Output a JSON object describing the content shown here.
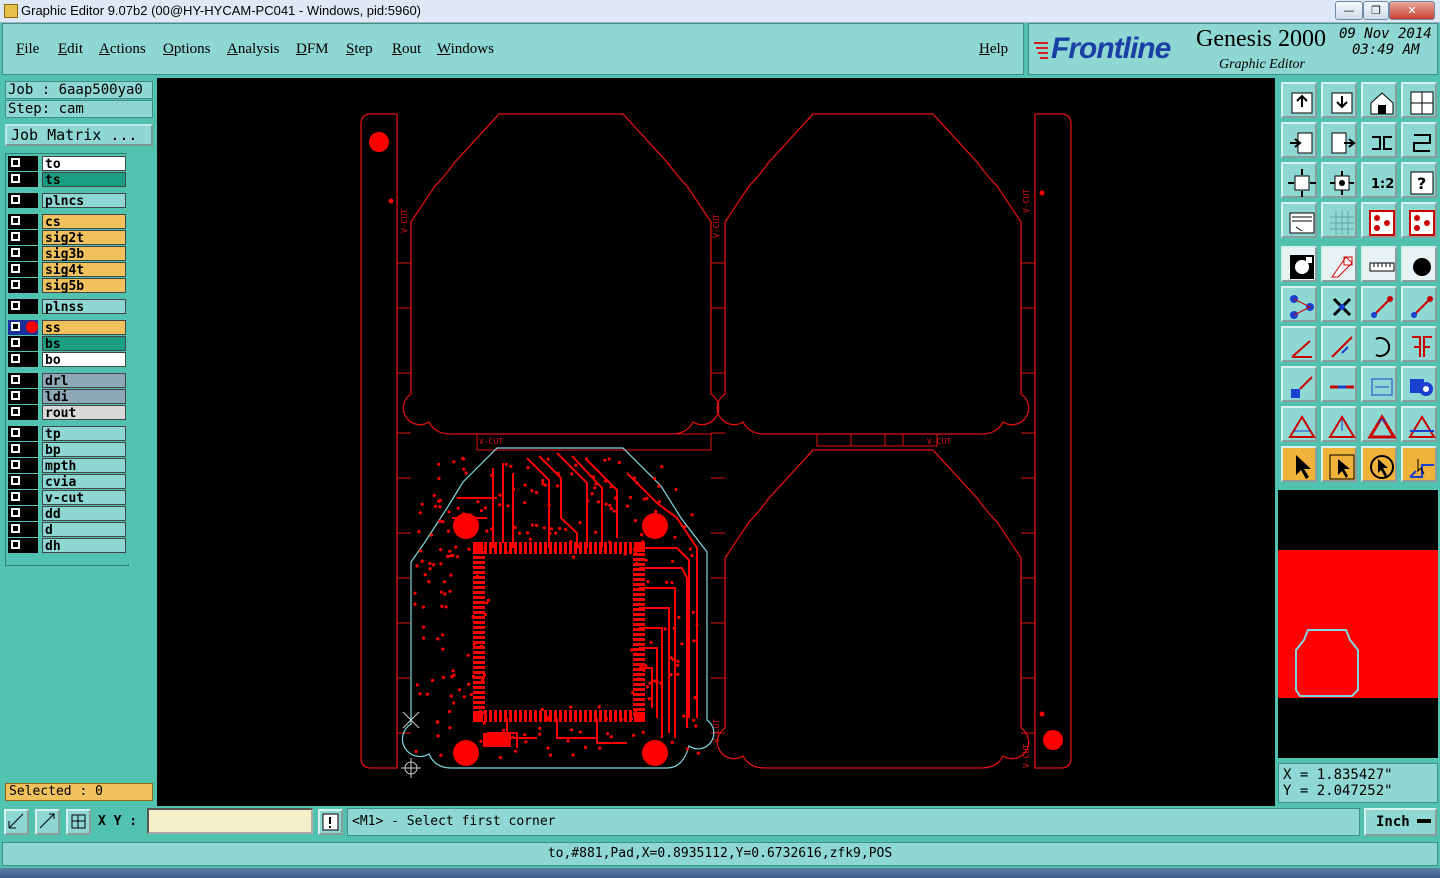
{
  "window": {
    "title": "Graphic Editor 9.07b2 (00@HY-HYCAM-PC041 - Windows, pid:5960)",
    "minimize": "—",
    "maximize": "❐",
    "close": "✕"
  },
  "menubar": {
    "items": [
      "File",
      "Edit",
      "Actions",
      "Options",
      "Analysis",
      "DFM",
      "Step",
      "Rout",
      "Windows"
    ],
    "help": "Help"
  },
  "brand": {
    "logo": "Frontline",
    "product": "Genesis 2000",
    "subtitle": "Graphic Editor",
    "date": "09 Nov 2014",
    "time": "03:49 AM"
  },
  "job": {
    "job_label": "Job : 6aap500ya0",
    "step_label": "Step: cam",
    "matrix_button": "Job Matrix ..."
  },
  "layers": [
    {
      "name": "to",
      "color": "#ffffff"
    },
    {
      "name": "ts",
      "color": "#199e82"
    },
    {
      "name": "plncs",
      "color": "#8fd7d3"
    },
    {
      "name": "cs",
      "color": "#f0c15c"
    },
    {
      "name": "sig2t",
      "color": "#f0c15c"
    },
    {
      "name": "sig3b",
      "color": "#f0c15c"
    },
    {
      "name": "sig4t",
      "color": "#f0c15c"
    },
    {
      "name": "sig5b",
      "color": "#f0c15c"
    },
    {
      "name": "plnss",
      "color": "#8fd7d3"
    },
    {
      "name": "ss",
      "color": "#f0c15c"
    },
    {
      "name": "bs",
      "color": "#199e82"
    },
    {
      "name": "bo",
      "color": "#ffffff"
    },
    {
      "name": "drl",
      "color": "#8fa8b8"
    },
    {
      "name": "ldi",
      "color": "#8fa8b8"
    },
    {
      "name": "rout",
      "color": "#d8d8d8"
    },
    {
      "name": "tp",
      "color": "#8fd7d3"
    },
    {
      "name": "bp",
      "color": "#8fd7d3"
    },
    {
      "name": "mpth",
      "color": "#8fd7d3"
    },
    {
      "name": "cvia",
      "color": "#8fd7d3"
    },
    {
      "name": "v-cut",
      "color": "#8fd7d3"
    },
    {
      "name": "dd",
      "color": "#8fd7d3"
    },
    {
      "name": "d",
      "color": "#8fd7d3"
    },
    {
      "name": "dh",
      "color": "#8fd7d3"
    }
  ],
  "selected": "Selected : 0",
  "canvas": {
    "vcut_label": "V-CUT"
  },
  "toolbar_icons": [
    "open-step-icon",
    "save-icon",
    "home-icon",
    "window-icon",
    "prev-icon",
    "next-icon",
    "undo-icon",
    "redo-icon",
    "fit-icon",
    "zoom-icon",
    "scale-icon",
    "help-icon",
    "measure-icon",
    "grid-icon",
    "snap-icon",
    "snap2-icon",
    "pad-icon",
    "shape-icon",
    "ruler-icon",
    "circle-icon",
    "net-icon",
    "cross-icon",
    "line-icon",
    "arc-icon",
    "edge-icon",
    "slope-icon",
    "rotate-icon",
    "mirror-icon",
    "move-icon",
    "break-icon",
    "span-icon",
    "group-icon",
    "tri1-icon",
    "tri2-icon",
    "tri3-icon",
    "tri4-icon",
    "pointer-icon",
    "select-icon",
    "mouse-icon",
    "route-icon"
  ],
  "coords": {
    "x": "X = 1.835427\"",
    "y": "Y = 2.047252\""
  },
  "bottom": {
    "xy_label": "X Y :",
    "xy_value": "",
    "prompt": "<M1> - Select first corner",
    "units": "Inch"
  },
  "status": "to,#881,Pad,X=0.8935112,Y=0.6732616,zfk9,POS",
  "colors": {
    "outline": "#e01010",
    "board": "#ff0000",
    "profile": "#7fd8e0",
    "panel_bg": "#52c2b0",
    "menu_bg": "#8fd7d3"
  }
}
